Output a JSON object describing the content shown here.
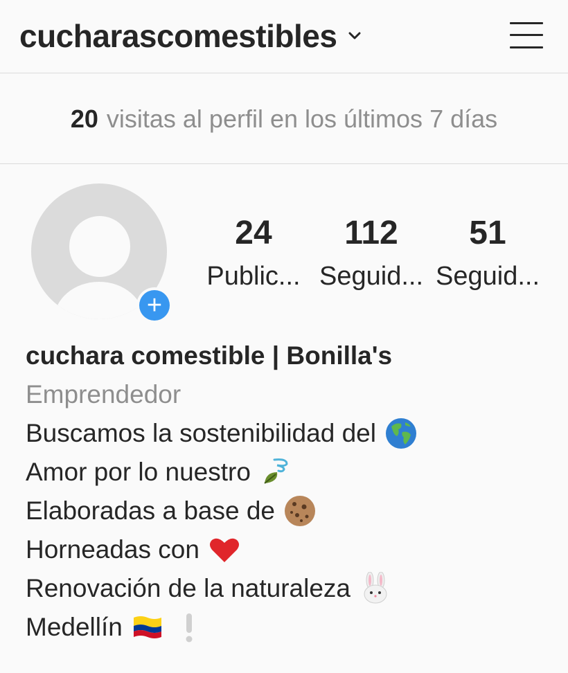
{
  "header": {
    "username": "cucharascomestibles",
    "menu_icon": "hamburger-menu-icon",
    "chevron_icon": "chevron-down-icon"
  },
  "insights": {
    "count": "20",
    "label": "visitas al perfil en los últimos 7 días"
  },
  "profile": {
    "avatar_icon": "default-avatar-icon",
    "add_story_icon": "plus-icon",
    "accent_color": "#3897f0",
    "stats": [
      {
        "value": "24",
        "label": "Public..."
      },
      {
        "value": "112",
        "label": "Seguid..."
      },
      {
        "value": "51",
        "label": "Seguid..."
      }
    ]
  },
  "bio": {
    "name": "cuchara comestible | Bonilla's",
    "category": "Emprendedor",
    "lines": [
      {
        "text": "Buscamos la sostenibilidad del",
        "emoji": "globe-americas-icon"
      },
      {
        "text": "Amor por lo nuestro",
        "emoji": "leaf-fluttering-in-wind-icon"
      },
      {
        "text": "Elaboradas a base de",
        "emoji": "cookie-icon"
      },
      {
        "text": "Horneadas con",
        "emoji": "red-heart-icon"
      },
      {
        "text": "Renovación de la naturaleza",
        "emoji": "rabbit-face-icon"
      },
      {
        "text": "Medellín",
        "emoji": "colombia-flag-icon",
        "emoji2": "white-exclamation-icon"
      }
    ]
  }
}
